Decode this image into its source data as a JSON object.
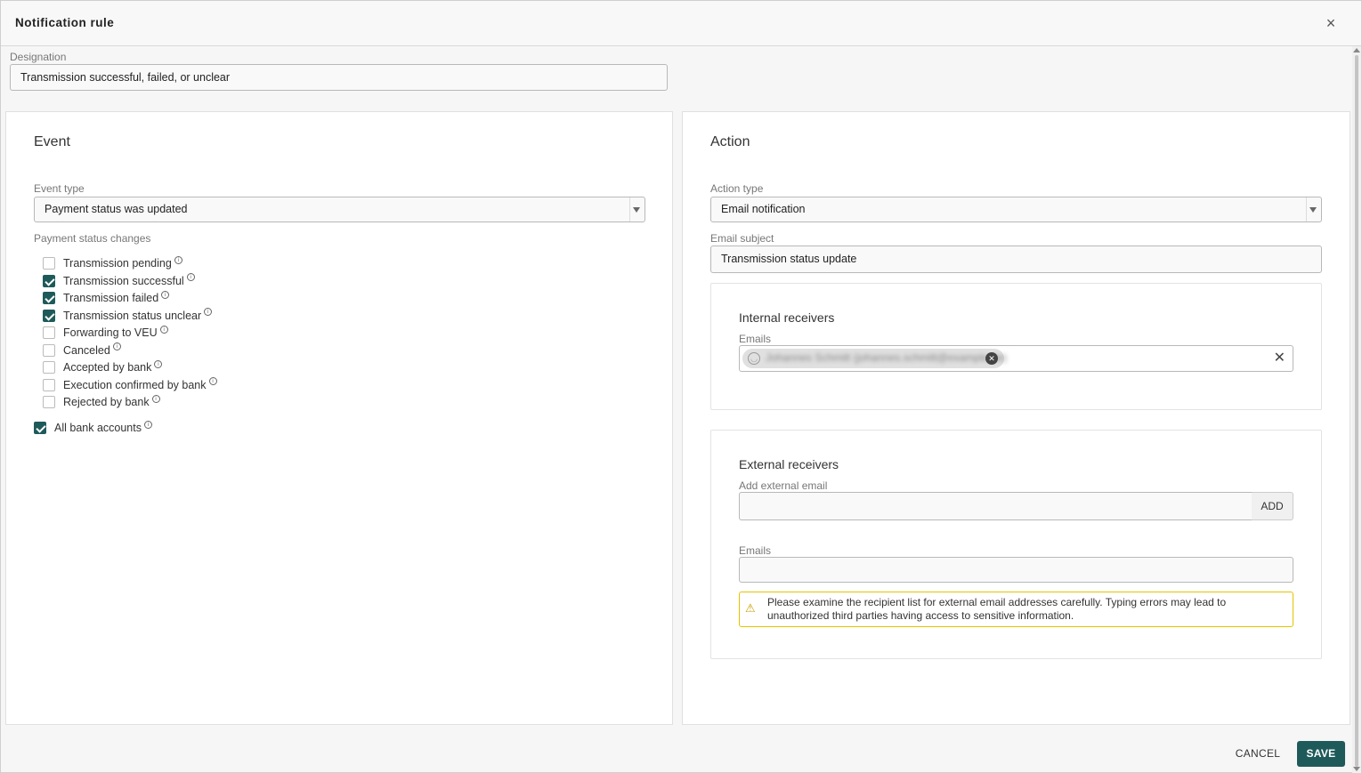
{
  "dialog": {
    "title": "Notification rule",
    "close_label": "×"
  },
  "designation": {
    "label": "Designation",
    "value": "Transmission successful, failed, or unclear"
  },
  "event": {
    "title": "Event",
    "event_type_label": "Event type",
    "event_type_value": "Payment status was updated",
    "status_changes_label": "Payment status changes",
    "statuses": [
      {
        "label": "Transmission pending",
        "checked": false
      },
      {
        "label": "Transmission successful",
        "checked": true
      },
      {
        "label": "Transmission failed",
        "checked": true
      },
      {
        "label": "Transmission status unclear",
        "checked": true
      },
      {
        "label": "Forwarding to VEU",
        "checked": false
      },
      {
        "label": "Canceled",
        "checked": false
      },
      {
        "label": "Accepted by bank",
        "checked": false
      },
      {
        "label": "Execution confirmed by bank",
        "checked": false
      },
      {
        "label": "Rejected by bank",
        "checked": false
      }
    ],
    "all_bank_accounts": {
      "label": "All bank accounts",
      "checked": true
    }
  },
  "action": {
    "title": "Action",
    "action_type_label": "Action type",
    "action_type_value": "Email notification",
    "email_subject_label": "Email subject",
    "email_subject_value": "Transmission status update",
    "internal": {
      "title": "Internal receivers",
      "emails_label": "Emails",
      "chip_text": "Johannes Schmitt (johannes.schmitt@example.de)"
    },
    "external": {
      "title": "External receivers",
      "add_label": "Add external email",
      "add_value": "",
      "add_button": "ADD",
      "emails_label": "Emails",
      "emails_value": "",
      "warning": "Please examine the recipient list for external email addresses carefully. Typing errors may lead to unauthorized third parties having access to sensitive information."
    }
  },
  "footer": {
    "cancel_label": "CANCEL",
    "save_label": "SAVE"
  },
  "colors": {
    "primary": "#1f5a5a",
    "warning_border": "#e5c300"
  }
}
